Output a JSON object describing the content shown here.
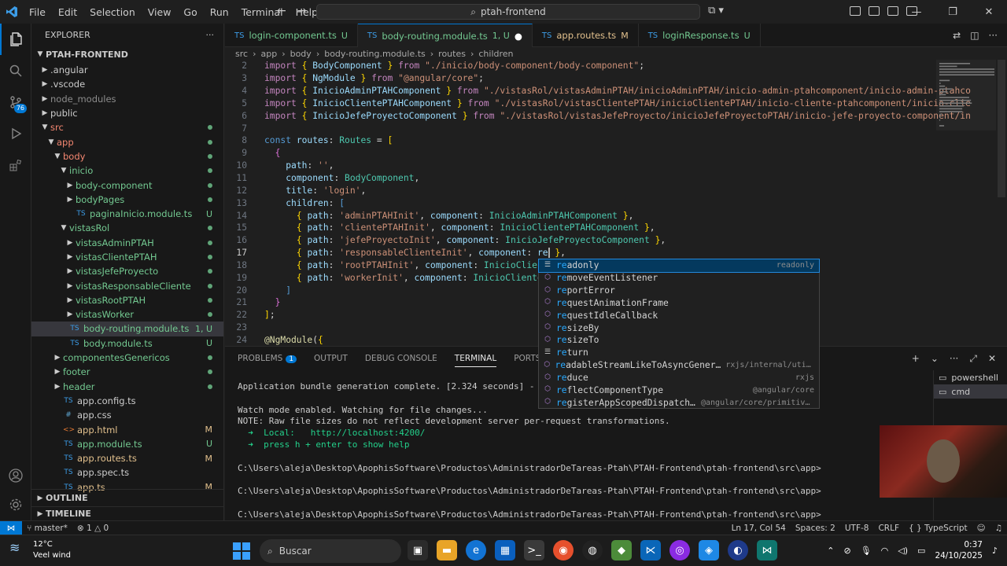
{
  "titlebar": {
    "menu": [
      "File",
      "Edit",
      "Selection",
      "View",
      "Go",
      "Run",
      "Terminal",
      "Help"
    ],
    "search": "ptah-frontend"
  },
  "activity": {
    "scm_badge": "76"
  },
  "explorer": {
    "title": "EXPLORER",
    "root": "PTAH-FRONTEND",
    "tree": [
      {
        "indent": 0,
        "type": "folder-closed",
        "label": ".angular",
        "cls": "c-folder",
        "st": ""
      },
      {
        "indent": 0,
        "type": "folder-closed",
        "label": ".vscode",
        "cls": "c-folder",
        "st": ""
      },
      {
        "indent": 0,
        "type": "folder-closed",
        "label": "node_modules",
        "cls": "c-dim",
        "st": ""
      },
      {
        "indent": 0,
        "type": "folder-closed",
        "label": "public",
        "cls": "c-folder",
        "st": ""
      },
      {
        "indent": 0,
        "type": "folder-open",
        "label": "src",
        "cls": "c-err",
        "st": "dot"
      },
      {
        "indent": 1,
        "type": "folder-open",
        "label": "app",
        "cls": "c-err",
        "st": "dot"
      },
      {
        "indent": 2,
        "type": "folder-open",
        "label": "body",
        "cls": "c-err",
        "st": "dot"
      },
      {
        "indent": 3,
        "type": "folder-open",
        "label": "inicio",
        "cls": "c-untracked",
        "st": "dot"
      },
      {
        "indent": 4,
        "type": "folder-closed",
        "label": "body-component",
        "cls": "c-untracked",
        "st": "dot"
      },
      {
        "indent": 4,
        "type": "folder-closed",
        "label": "bodyPages",
        "cls": "c-untracked",
        "st": "dot"
      },
      {
        "indent": 4,
        "type": "ts",
        "label": "paginaInicio.module.ts",
        "cls": "c-untracked",
        "st": "U"
      },
      {
        "indent": 3,
        "type": "folder-open",
        "label": "vistasRol",
        "cls": "c-untracked",
        "st": "dot"
      },
      {
        "indent": 4,
        "type": "folder-closed",
        "label": "vistasAdminPTAH",
        "cls": "c-untracked",
        "st": "dot"
      },
      {
        "indent": 4,
        "type": "folder-closed",
        "label": "vistasClientePTAH",
        "cls": "c-untracked",
        "st": "dot"
      },
      {
        "indent": 4,
        "type": "folder-closed",
        "label": "vistasJefeProyecto",
        "cls": "c-untracked",
        "st": "dot"
      },
      {
        "indent": 4,
        "type": "folder-closed",
        "label": "vistasResponsableCliente",
        "cls": "c-untracked",
        "st": "dot"
      },
      {
        "indent": 4,
        "type": "folder-closed",
        "label": "vistasRootPTAH",
        "cls": "c-untracked",
        "st": "dot"
      },
      {
        "indent": 4,
        "type": "folder-closed",
        "label": "vistasWorker",
        "cls": "c-untracked",
        "st": "dot"
      },
      {
        "indent": 3,
        "type": "ts",
        "label": "body-routing.module.ts",
        "cls": "c-untracked",
        "st": "1, U",
        "selected": true
      },
      {
        "indent": 3,
        "type": "ts",
        "label": "body.module.ts",
        "cls": "c-untracked",
        "st": "U"
      },
      {
        "indent": 2,
        "type": "folder-closed",
        "label": "componentesGenericos",
        "cls": "c-untracked",
        "st": "dot"
      },
      {
        "indent": 2,
        "type": "folder-closed",
        "label": "footer",
        "cls": "c-untracked",
        "st": "dot"
      },
      {
        "indent": 2,
        "type": "folder-closed",
        "label": "header",
        "cls": "c-untracked",
        "st": "dot"
      },
      {
        "indent": 2,
        "type": "ts",
        "label": "app.config.ts",
        "cls": "c-folder",
        "st": ""
      },
      {
        "indent": 2,
        "type": "css",
        "label": "app.css",
        "cls": "c-folder",
        "st": ""
      },
      {
        "indent": 2,
        "type": "html",
        "label": "app.html",
        "cls": "c-mod",
        "st": "M"
      },
      {
        "indent": 2,
        "type": "ts",
        "label": "app.module.ts",
        "cls": "c-untracked",
        "st": "U"
      },
      {
        "indent": 2,
        "type": "ts",
        "label": "app.routes.ts",
        "cls": "c-mod",
        "st": "M"
      },
      {
        "indent": 2,
        "type": "ts",
        "label": "app.spec.ts",
        "cls": "c-folder",
        "st": ""
      },
      {
        "indent": 2,
        "type": "ts",
        "label": "app.ts",
        "cls": "c-mod",
        "st": "M"
      }
    ],
    "outline": "OUTLINE",
    "timeline": "TIMELINE"
  },
  "tabs": [
    {
      "label": "login-component.ts",
      "status": "U",
      "cls": "c-untracked",
      "active": false
    },
    {
      "label": "body-routing.module.ts",
      "status": "1, U",
      "cls": "c-untracked",
      "active": true
    },
    {
      "label": "app.routes.ts",
      "status": "M",
      "cls": "c-mod",
      "active": false
    },
    {
      "label": "loginResponse.ts",
      "status": "U",
      "cls": "c-untracked",
      "active": false
    }
  ],
  "breadcrumb": [
    "src",
    "app",
    "body",
    "body-routing.module.ts",
    "routes",
    "children"
  ],
  "code": {
    "lines": [
      {
        "n": "2",
        "html": "<span class='k'>import</span> <span class='y'>{</span> <span class='v'>BodyComponent</span> <span class='y'>}</span> <span class='k'>from</span> <span class='s'>\"./inicio/body-component/body-component\"</span>;"
      },
      {
        "n": "3",
        "html": "<span class='k'>import</span> <span class='y'>{</span> <span class='v'>NgModule</span> <span class='y'>}</span> <span class='k'>from</span> <span class='s'>\"@angular/core\"</span>;"
      },
      {
        "n": "4",
        "html": "<span class='k'>import</span> <span class='y'>{</span> <span class='v'>InicioAdminPTAHComponent</span> <span class='y'>}</span> <span class='k'>from</span> <span class='s'>\"./vistasRol/vistasAdminPTAH/inicioAdminPTAH/inicio-admin-ptahcomponent/inicio-admin-ptahco</span>"
      },
      {
        "n": "5",
        "html": "<span class='k'>import</span> <span class='y'>{</span> <span class='v'>InicioClientePTAHComponent</span> <span class='y'>}</span> <span class='k'>from</span> <span class='s'>\"./vistasRol/vistasClientePTAH/inicioClientePTAH/inicio-cliente-ptahcomponent/inicio-clie</span>"
      },
      {
        "n": "6",
        "html": "<span class='k'>import</span> <span class='y'>{</span> <span class='v'>InicioJefeProyectoComponent</span> <span class='y'>}</span> <span class='k'>from</span> <span class='s'>\"./vistasRol/vistasJefeProyecto/inicioJefeProyectoPTAH/inicio-jefe-proyecto-component/in</span>"
      },
      {
        "n": "7",
        "html": ""
      },
      {
        "n": "8",
        "html": "<span class='kw'>const</span> <span class='v'>routes</span>: <span class='t'>Routes</span> = <span class='y'>[</span>"
      },
      {
        "n": "9",
        "html": "  <span class='p'>{</span>"
      },
      {
        "n": "10",
        "html": "    <span class='v'>path</span>: <span class='s'>''</span>,"
      },
      {
        "n": "11",
        "html": "    <span class='v'>component</span>: <span class='t'>BodyComponent</span>,"
      },
      {
        "n": "12",
        "html": "    <span class='v'>title</span>: <span class='s'>'login'</span>,"
      },
      {
        "n": "13",
        "html": "    <span class='v'>children</span>: <span class='kw'>[</span>"
      },
      {
        "n": "14",
        "html": "      <span class='y'>{</span> <span class='v'>path</span>: <span class='s'>'adminPTAHInit'</span>, <span class='v'>component</span>: <span class='t'>InicioAdminPTAHComponent</span> <span class='y'>}</span>,"
      },
      {
        "n": "15",
        "html": "      <span class='y'>{</span> <span class='v'>path</span>: <span class='s'>'clientePTAHInit'</span>, <span class='v'>component</span>: <span class='t'>InicioClientePTAHComponent</span> <span class='y'>}</span>,"
      },
      {
        "n": "16",
        "html": "      <span class='y'>{</span> <span class='v'>path</span>: <span class='s'>'jefeProyectoInit'</span>, <span class='v'>component</span>: <span class='t'>InicioJefeProyectoComponent</span> <span class='y'>}</span>,"
      },
      {
        "n": "17",
        "html": "      <span class='y'>{</span> <span class='v'>path</span>: <span class='s'>'responsableClienteInit'</span>, <span class='v'>component</span>: <span class='v'>re</span><span class='cursor'></span> <span class='y'>}</span>,",
        "cur": true
      },
      {
        "n": "18",
        "html": "      <span class='y'>{</span> <span class='v'>path</span>: <span class='s'>'rootPTAHInit'</span>, <span class='v'>component</span>: <span class='t'>InicioClient</span>"
      },
      {
        "n": "19",
        "html": "      <span class='y'>{</span> <span class='v'>path</span>: <span class='s'>'workerInit'</span>, <span class='v'>component</span>: <span class='t'>InicioClienteP</span>"
      },
      {
        "n": "20",
        "html": "    <span class='kw'>]</span>"
      },
      {
        "n": "21",
        "html": "  <span class='p'>}</span>"
      },
      {
        "n": "22",
        "html": "<span class='y'>]</span>;"
      },
      {
        "n": "23",
        "html": ""
      },
      {
        "n": "24",
        "html": "<span class='f'>@NgModule</span>(<span class='y'>{</span>"
      }
    ]
  },
  "suggest": [
    {
      "label": "readonly",
      "match": "re",
      "rest": "adonly",
      "detail": "readonly",
      "focus": true,
      "icon": "keyword"
    },
    {
      "label": "removeEventListener",
      "match": "re",
      "rest": "moveEventListener",
      "detail": "",
      "icon": "method"
    },
    {
      "label": "reportError",
      "match": "re",
      "rest": "portError",
      "detail": "",
      "icon": "method"
    },
    {
      "label": "requestAnimationFrame",
      "match": "re",
      "rest": "questAnimationFrame",
      "detail": "",
      "icon": "method"
    },
    {
      "label": "requestIdleCallback",
      "match": "re",
      "rest": "questIdleCallback",
      "detail": "",
      "icon": "method"
    },
    {
      "label": "resizeBy",
      "match": "re",
      "rest": "sizeBy",
      "detail": "",
      "icon": "method"
    },
    {
      "label": "resizeTo",
      "match": "re",
      "rest": "sizeTo",
      "detail": "",
      "icon": "method"
    },
    {
      "label": "return",
      "match": "re",
      "rest": "turn",
      "detail": "",
      "icon": "keyword"
    },
    {
      "label": "readableStreamLikeToAsyncGener…",
      "match": "re",
      "rest": "adableStreamLikeToAsyncGener…",
      "detail": "rxjs/internal/util/i…",
      "icon": "function"
    },
    {
      "label": "reduce",
      "match": "re",
      "rest": "duce",
      "detail": "rxjs",
      "icon": "function"
    },
    {
      "label": "reflectComponentType",
      "match": "re",
      "rest": "flectComponentType",
      "detail": "@angular/core",
      "icon": "function"
    },
    {
      "label": "registerAppScopedDispatch…",
      "match": "re",
      "rest": "gisterAppScopedDispatch…",
      "detail": "@angular/core/primitives/e…",
      "icon": "function"
    }
  ],
  "panel": {
    "tabs": [
      "PROBLEMS",
      "OUTPUT",
      "DEBUG CONSOLE",
      "TERMINAL",
      "PORTS"
    ],
    "problems_count": "1",
    "active_tab": "TERMINAL",
    "terminal_lines": [
      "Application bundle generation complete. [2.324 seconds] - 2025-",
      "",
      "Watch mode enabled. Watching for file changes...",
      "NOTE: Raw file sizes do not reflect development server per-request transformations.",
      "  ➜  Local:   http://localhost:4200/",
      "  ➜  press h + enter to show help",
      "",
      "C:\\Users\\aleja\\Desktop\\ApophisSoftware\\Productos\\AdministradorDeTareas-Ptah\\PTAH-Frontend\\ptah-frontend\\src\\app>",
      "",
      "C:\\Users\\aleja\\Desktop\\ApophisSoftware\\Productos\\AdministradorDeTareas-Ptah\\PTAH-Frontend\\ptah-frontend\\src\\app>",
      "",
      "C:\\Users\\aleja\\Desktop\\ApophisSoftware\\Productos\\AdministradorDeTareas-Ptah\\PTAH-Frontend\\ptah-frontend\\src\\app>"
    ],
    "terminals": [
      "powershell",
      "cmd"
    ]
  },
  "statusbar": {
    "branch": "master*",
    "errors": "1",
    "warnings": "0",
    "position": "Ln 17, Col 54",
    "spaces": "Spaces: 2",
    "encoding": "UTF-8",
    "eol": "CRLF",
    "language": "TypeScript"
  },
  "taskbar": {
    "temp": "12°C",
    "weather": "Veel wind",
    "search": "Buscar",
    "time": "0:37",
    "date": "24/10/2025"
  }
}
